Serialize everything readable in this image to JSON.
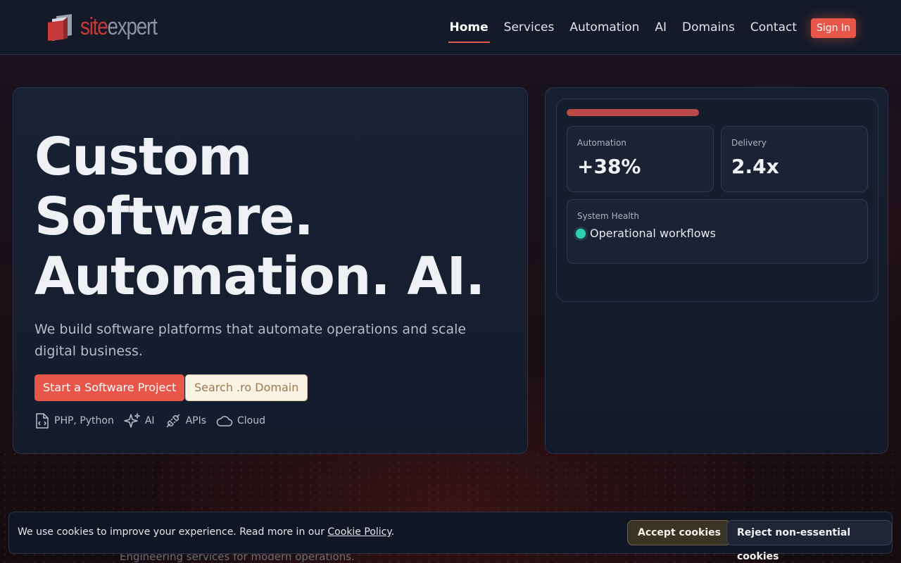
{
  "brand": {
    "logo_part1": "site",
    "logo_part2": "expert"
  },
  "nav": {
    "items": [
      {
        "label": "Home",
        "active": true
      },
      {
        "label": "Services"
      },
      {
        "label": "Automation"
      },
      {
        "label": "AI"
      },
      {
        "label": "Domains"
      },
      {
        "label": "Contact"
      }
    ],
    "sign_in": "Sign In"
  },
  "hero": {
    "title_line1": "Custom",
    "title_line2": "Software.",
    "title_line3": "Automation. AI.",
    "description": "We build software platforms that automate operations and scale digital business.",
    "primary_cta": "Start a Software Project",
    "secondary_cta": "Search .ro Domain",
    "tags": [
      {
        "icon": "file-code-icon",
        "label": "PHP, Python"
      },
      {
        "icon": "sparkles-icon",
        "label": "AI"
      },
      {
        "icon": "plug-icon",
        "label": "APIs"
      },
      {
        "icon": "cloud-icon",
        "label": "Cloud"
      }
    ]
  },
  "dashboard": {
    "stats": [
      {
        "label": "Automation",
        "value": "+38%"
      },
      {
        "label": "Delivery",
        "value": "2.4x"
      }
    ],
    "health": {
      "label": "System Health",
      "status": "Operational workflows",
      "status_color": "#2fd0b8"
    }
  },
  "section": {
    "subtitle": "Engineering services for modern operations."
  },
  "cookie": {
    "text": "We use cookies to improve your experience. Read more in our ",
    "link": "Cookie Policy",
    "after_link": ".",
    "accept": "Accept cookies",
    "reject": "Reject non-essential cookies"
  },
  "colors": {
    "accent": "#e8564a",
    "background": "#141a28",
    "success": "#2fd0b8"
  }
}
